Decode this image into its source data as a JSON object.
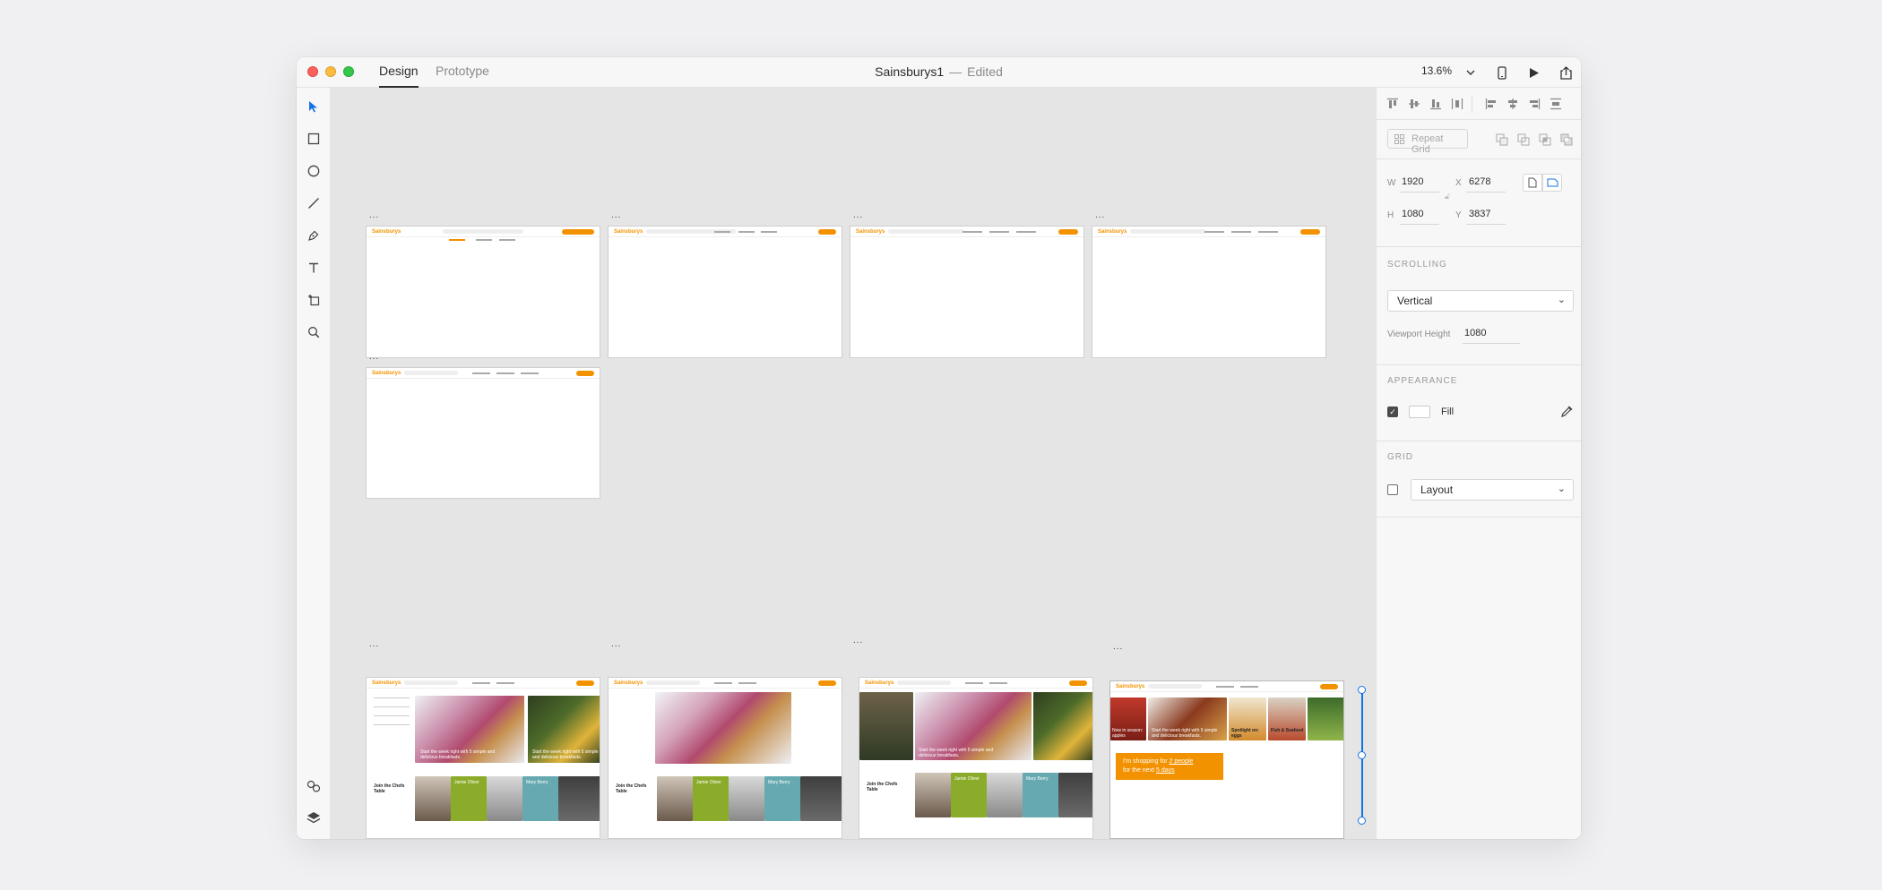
{
  "window": {
    "tabs": [
      {
        "label": "Design",
        "active": true
      },
      {
        "label": "Prototype",
        "active": false
      }
    ],
    "doc_title": "Sainsburys1",
    "doc_sep": "—",
    "doc_status": "Edited",
    "zoom": "13.6%"
  },
  "toolbar": {
    "tools": [
      "select-icon",
      "rectangle-icon",
      "ellipse-icon",
      "line-icon",
      "pen-icon",
      "text-icon",
      "artboard-icon",
      "zoom-icon"
    ],
    "bottom": [
      "assets-icon",
      "layers-icon"
    ]
  },
  "canvas": {
    "artboard_label": "...",
    "logo_text": "Sainsburys",
    "shop_box": {
      "line1_prefix": "I'm shopping for",
      "line1_value": "2 people",
      "line2_prefix": "for the next",
      "line2_value": "5 days"
    },
    "card_texts": {
      "start_week": "Start the week right with 5 simple and delicious breakfasts.",
      "join_chefs": "Join the Chefs Table",
      "jamie": "Jamie Oliver",
      "mary": "Mary Berry",
      "in_season": "Now in season: apples",
      "spotlight": "Spotlight on: eggs",
      "fish": "Fish & Seafood"
    }
  },
  "panel": {
    "repeat_grid_label": "Repeat Grid",
    "w_label": "W",
    "w_value": "1920",
    "x_label": "X",
    "x_value": "6278",
    "h_label": "H",
    "h_value": "1080",
    "y_label": "Y",
    "y_value": "3837",
    "scrolling_heading": "SCROLLING",
    "scrolling_value": "Vertical",
    "viewport_label": "Viewport Height",
    "viewport_value": "1080",
    "appearance_heading": "APPEARANCE",
    "fill_label": "Fill",
    "fill_checked": true,
    "grid_heading": "GRID",
    "grid_value": "Layout",
    "grid_checked": false
  },
  "colors": {
    "accent": "#f39200",
    "selection": "#1473e6",
    "canvas": "#e5e5e5"
  }
}
